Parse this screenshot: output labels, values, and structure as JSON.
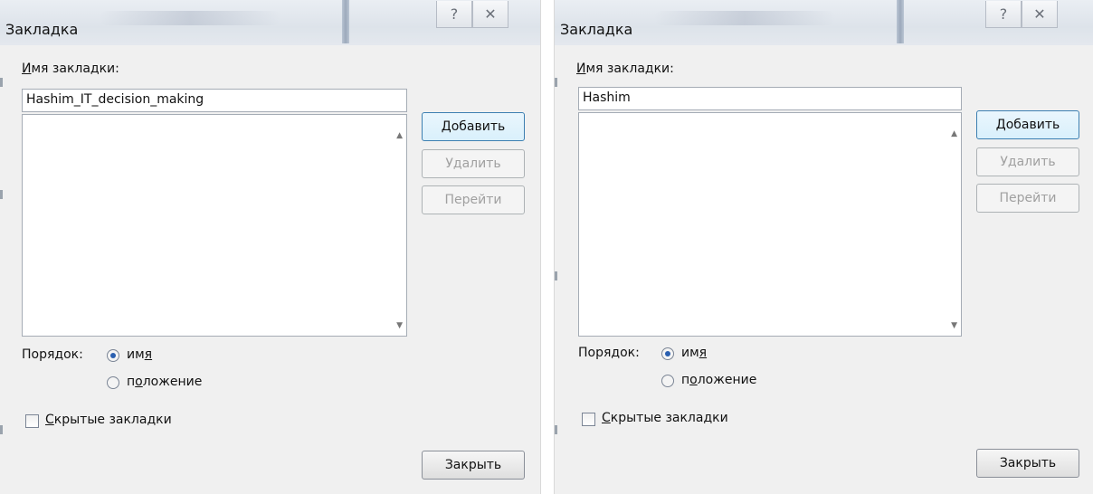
{
  "dialogs": [
    {
      "title": "Закладка",
      "help_icon": "?",
      "close_icon": "✕",
      "name_label": {
        "mnemonic": "И",
        "rest": "мя закладки:"
      },
      "name_value": "Hashim_IT_decision_making",
      "buttons": {
        "add": {
          "mnemonic": "Д",
          "rest": "обавить"
        },
        "delete": "Удалить",
        "goto": "Перейти",
        "close": "Закрыть"
      },
      "order_label": "Порядок:",
      "order_options": [
        {
          "pre": "им",
          "mnemonic": "я",
          "post": "",
          "checked": true
        },
        {
          "pre": "п",
          "mnemonic": "о",
          "post": "ложение",
          "checked": false
        }
      ],
      "hidden_bookmarks": {
        "mnemonic": "С",
        "rest": "крытые закладки",
        "checked": false
      }
    },
    {
      "title": "Закладка",
      "help_icon": "?",
      "close_icon": "✕",
      "name_label": {
        "mnemonic": "И",
        "rest": "мя закладки:"
      },
      "name_value": "Hashim",
      "buttons": {
        "add": {
          "mnemonic": "Д",
          "rest": "обавить"
        },
        "delete": "Удалить",
        "goto": "Перейти",
        "close": "Закрыть"
      },
      "order_label": "Порядок:",
      "order_options": [
        {
          "pre": "им",
          "mnemonic": "я",
          "post": "",
          "checked": true
        },
        {
          "pre": "п",
          "mnemonic": "о",
          "post": "ложение",
          "checked": false
        }
      ],
      "hidden_bookmarks": {
        "mnemonic": "С",
        "rest": "крытые закладки",
        "checked": false
      }
    }
  ]
}
